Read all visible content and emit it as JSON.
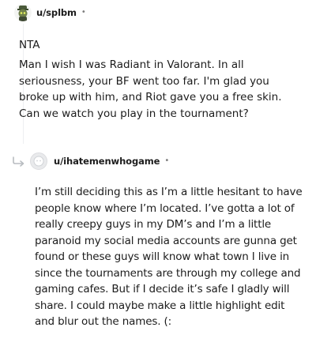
{
  "comments": [
    {
      "username": "u/splbm",
      "separator": "•",
      "verdict": "NTA",
      "body": "Man I wish I was Radiant in Valorant. In all seriousness, your BF went too far. I'm glad you broke up with him, and Riot gave you a free skin. Can we watch you play in the tournament?",
      "avatar_icon": "snoo-avatar-icon"
    },
    {
      "username": "u/ihatemenwhogame",
      "separator": "•",
      "body": "I’m still deciding this as I’m a little hesitant to have people know where I’m located. I’ve gotta a lot of really creepy guys in my DM’s and I’m a little paranoid my social media accounts are gunna get found or these guys will know what town I live in since the tournaments are through my college and gaming cafes. But if I decide it’s safe I gladly will share. I could maybe make a little highlight edit and blur out the names. (:",
      "avatar_icon": "default-avatar-icon",
      "reply_icon": "reply-arrow-icon"
    }
  ],
  "colors": {
    "text": "#1c1c1c",
    "meta": "#7c7c7c",
    "thread_line": "#edeff1",
    "avatar_bg": "#e9eaec"
  }
}
